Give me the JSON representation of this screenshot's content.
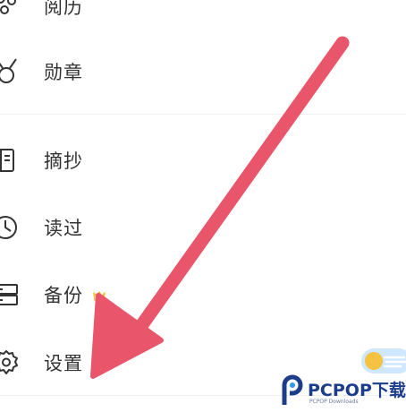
{
  "menu": {
    "items": [
      {
        "label": "阅历",
        "icon": "bubbles-icon"
      },
      {
        "label": "勋章",
        "icon": "medal-icon"
      },
      {
        "label": "摘抄",
        "icon": "notebook-icon"
      },
      {
        "label": "读过",
        "icon": "clock-icon"
      },
      {
        "label": "备份",
        "icon": "server-icon",
        "badge": "crown-icon"
      },
      {
        "label": "设置",
        "icon": "gear-icon"
      }
    ]
  },
  "annotation": {
    "arrow_color": "#e9556b",
    "direction": "pointing to 设置"
  },
  "colors": {
    "toggle_bg": "#cfe7ff",
    "toggle_knob": "#f5c242",
    "crown": "#f0c23a",
    "watermark_blue": "#1c3c8c"
  },
  "watermark": {
    "title": "PCPOP下载",
    "subtitle": "PCPOP Downloads"
  }
}
